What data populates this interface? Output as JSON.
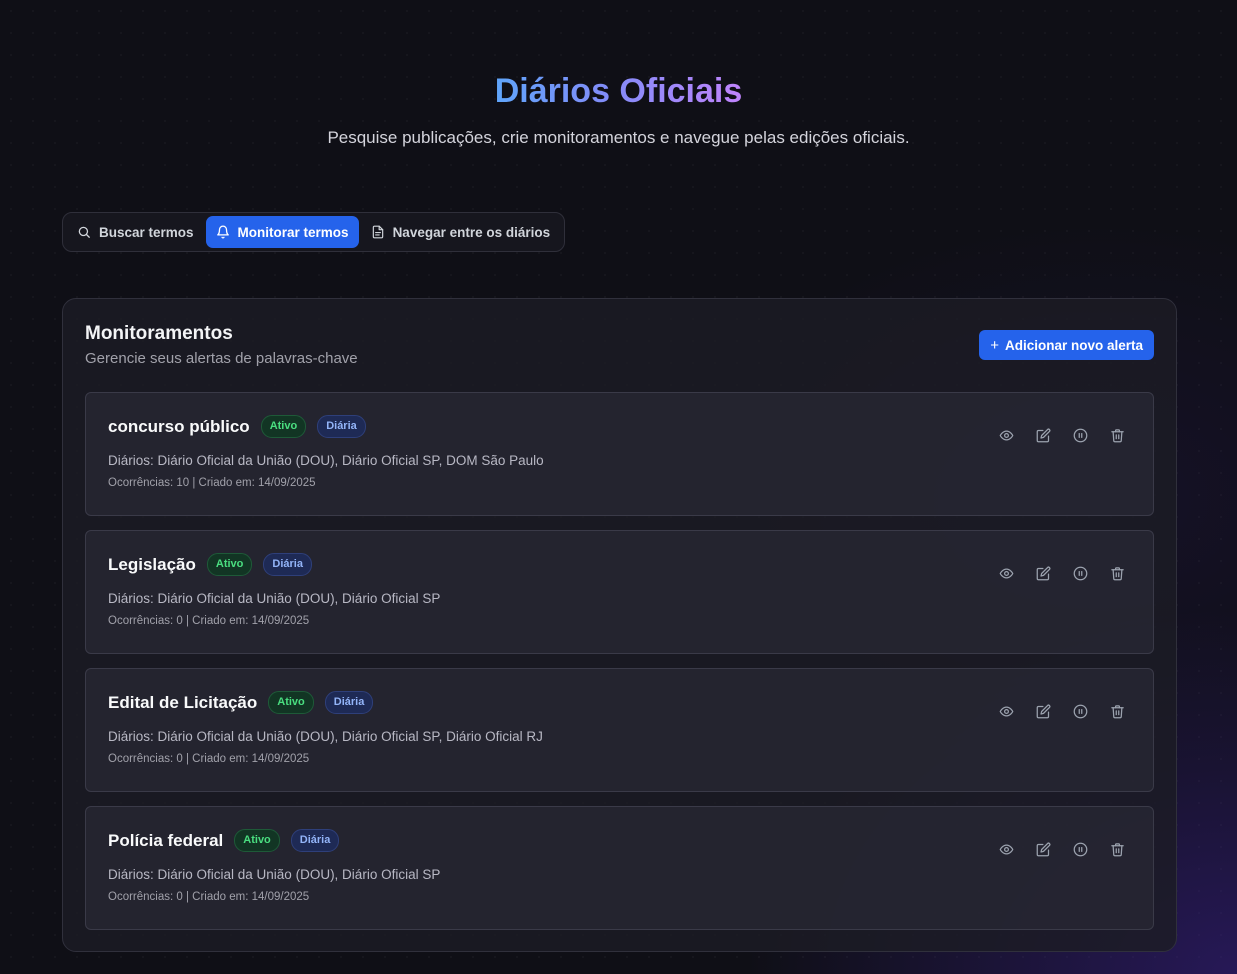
{
  "header": {
    "title": "Diários Oficiais",
    "subtitle": "Pesquise publicações, crie monitoramentos e navegue pelas edições oficiais."
  },
  "tabs": [
    {
      "label": "Buscar termos",
      "icon": "search-icon",
      "active": false
    },
    {
      "label": "Monitorar termos",
      "icon": "bell-icon",
      "active": true
    },
    {
      "label": "Navegar entre os diários",
      "icon": "file-text-icon",
      "active": false
    }
  ],
  "panel": {
    "title": "Monitoramentos",
    "subtitle": "Gerencie seus alertas de palavras-chave",
    "add_button_plus": "+",
    "add_button_label": "Adicionar novo alerta"
  },
  "monitors": [
    {
      "name": "concurso público",
      "status": "Ativo",
      "frequency": "Diária",
      "diaries": "Diários: Diário Oficial da União (DOU), Diário Oficial SP, DOM São Paulo",
      "meta": "Ocorrências: 10 | Criado em: 14/09/2025"
    },
    {
      "name": "Legislação",
      "status": "Ativo",
      "frequency": "Diária",
      "diaries": "Diários: Diário Oficial da União (DOU), Diário Oficial SP",
      "meta": "Ocorrências: 0 | Criado em: 14/09/2025"
    },
    {
      "name": "Edital de Licitação",
      "status": "Ativo",
      "frequency": "Diária",
      "diaries": "Diários: Diário Oficial da União (DOU), Diário Oficial SP, Diário Oficial RJ",
      "meta": "Ocorrências: 0 | Criado em: 14/09/2025"
    },
    {
      "name": "Polícia federal",
      "status": "Ativo",
      "frequency": "Diária",
      "diaries": "Diários: Diário Oficial da União (DOU), Diário Oficial SP",
      "meta": "Ocorrências: 0 | Criado em: 14/09/2025"
    }
  ],
  "actions": [
    "eye-icon",
    "edit-icon",
    "pause-icon",
    "trash-icon"
  ],
  "colors": {
    "accent": "#2563eb",
    "title_gradient_start": "#60a5fa",
    "title_gradient_end": "#c084fc",
    "active_badge": "#4ade80",
    "frequency_badge": "#93b4f8"
  }
}
